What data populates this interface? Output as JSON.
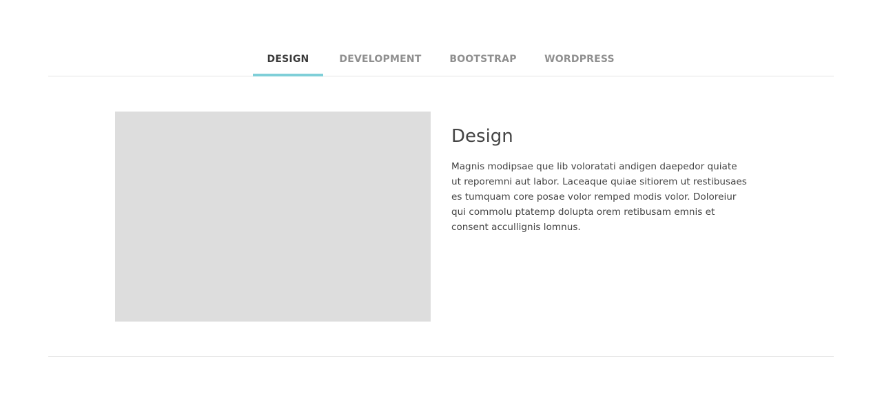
{
  "tabs": [
    {
      "label": "DESIGN",
      "active": true
    },
    {
      "label": "DEVELOPMENT",
      "active": false
    },
    {
      "label": "BOOTSTRAP",
      "active": false
    },
    {
      "label": "WORDPRESS",
      "active": false
    }
  ],
  "colors": {
    "accent": "#7fcfd8",
    "placeholder": "#dddddd",
    "rule": "#e3e3e3",
    "tab_inactive": "#8f8f8f",
    "tab_active": "#3a3a3a"
  },
  "panel": {
    "title": "Design",
    "body": "Magnis modipsae que lib voloratati andigen daepedor quiate ut reporemni aut labor. Laceaque quiae sitiorem ut restibusaes es tumquam core posae volor remped modis volor. Doloreiur qui commolu ptatemp dolupta orem retibusam emnis et consent accullignis lomnus."
  }
}
